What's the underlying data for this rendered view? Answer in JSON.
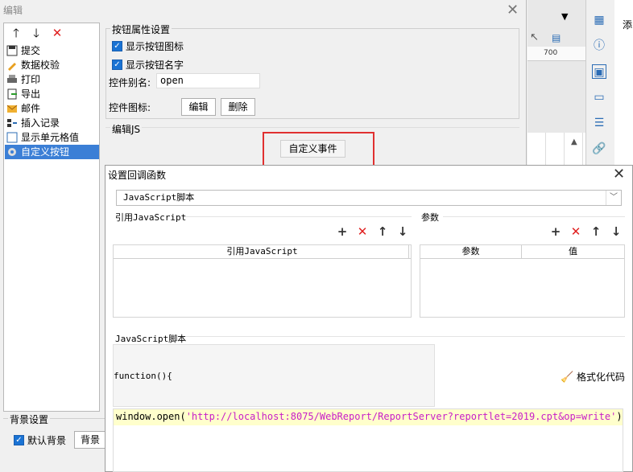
{
  "edit_dialog": {
    "title": "编辑",
    "close": "✕",
    "list_items": [
      {
        "label": "提交"
      },
      {
        "label": "数据校验"
      },
      {
        "label": "打印"
      },
      {
        "label": "导出"
      },
      {
        "label": "邮件"
      },
      {
        "label": "插入记录"
      },
      {
        "label": "显示单元格值"
      },
      {
        "label": "自定义按钮"
      }
    ],
    "props_group_title": "按钮属性设置",
    "show_icon_label": "显示按钮图标",
    "show_name_label": "显示按钮名字",
    "alias_label": "控件别名:",
    "alias_value": "open",
    "icon_label": "控件图标:",
    "edit_button": "编辑",
    "delete_button": "删除",
    "js_group_title": "编辑JS",
    "custom_event_button": "自定义事件",
    "bg_group_title": "背景设置",
    "default_bg_label": "默认背景",
    "bg_button": "背景设"
  },
  "right_panel": {
    "ruler_value": "700",
    "side_text": "添"
  },
  "callback_dialog": {
    "title": "设置回调函数",
    "close": "✕",
    "language_select": "JavaScript脚本",
    "ref_js_section": "引用JavaScript",
    "params_section": "参数",
    "ref_js_column": "引用JavaScript",
    "params_columns": [
      "参数",
      "值"
    ],
    "script_section": "JavaScript脚本",
    "function_header": "function(){",
    "format_code_label": "格式化代码",
    "code": {
      "prefix": "window.open(",
      "string": "'http://localhost:8075/WebReport/ReportServer?reportlet=2019.cpt&op=write'",
      "suffix": ")"
    }
  },
  "colors": {
    "selection": "#3b7fd6",
    "highlight_border": "#e03030",
    "code_highlight": "#ffffcc",
    "string_color": "#c81ec8"
  }
}
